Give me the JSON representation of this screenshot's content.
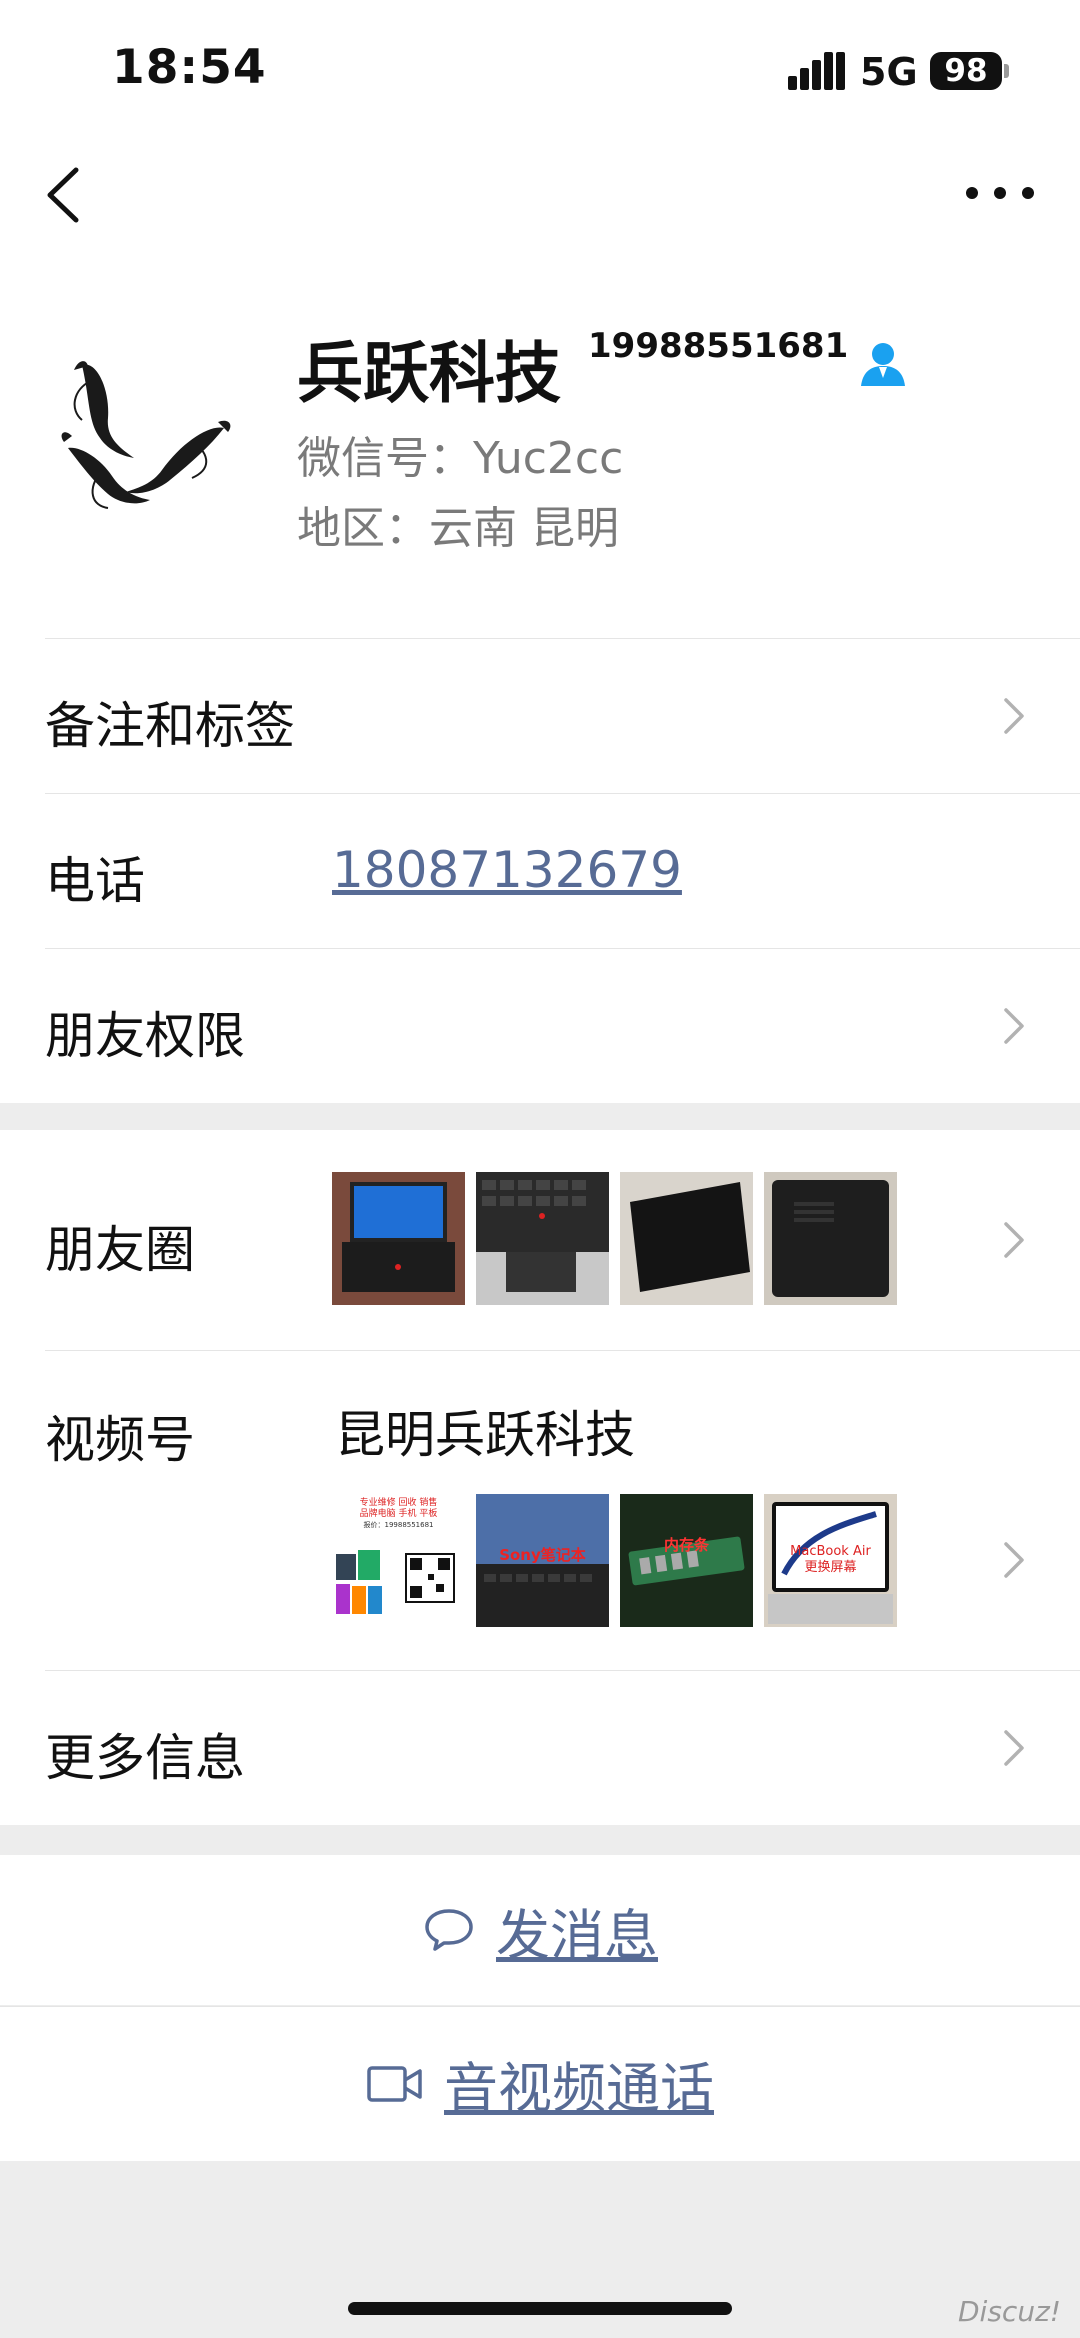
{
  "status_bar": {
    "time": "18:54",
    "network": "5G",
    "battery": "98"
  },
  "profile": {
    "name": "兵跃科技",
    "name_suffix": "19988551681",
    "wechat_id": "微信号：Yuc2cc",
    "region": "地区：云南 昆明"
  },
  "rows": {
    "remarks": "备注和标签",
    "phone_label": "电话",
    "phone_value": "18087132679",
    "permissions": "朋友权限",
    "moments": "朋友圈",
    "channels_label": "视频号",
    "channels_name": "昆明兵跃科技",
    "more_info": "更多信息"
  },
  "channel_thumbs": {
    "t1_line1": "专业维修 回收 销售",
    "t1_line2": "品牌电脑 手机 平板",
    "t1_line3": "报价：19988551681",
    "t2": "Sony笔记本",
    "t3": "内存条",
    "t4_line1": "MacBook Air",
    "t4_line2": "更换屏幕"
  },
  "actions": {
    "message": "发消息",
    "call": "音视频通话"
  },
  "watermark": "Discuz!",
  "colors": {
    "link": "#576b95",
    "contact_icon": "#1aa1f0"
  },
  "icons": [
    "back-icon",
    "more-icon",
    "contact-icon",
    "chevron-right-icon",
    "chat-bubble-icon",
    "video-camera-icon"
  ]
}
